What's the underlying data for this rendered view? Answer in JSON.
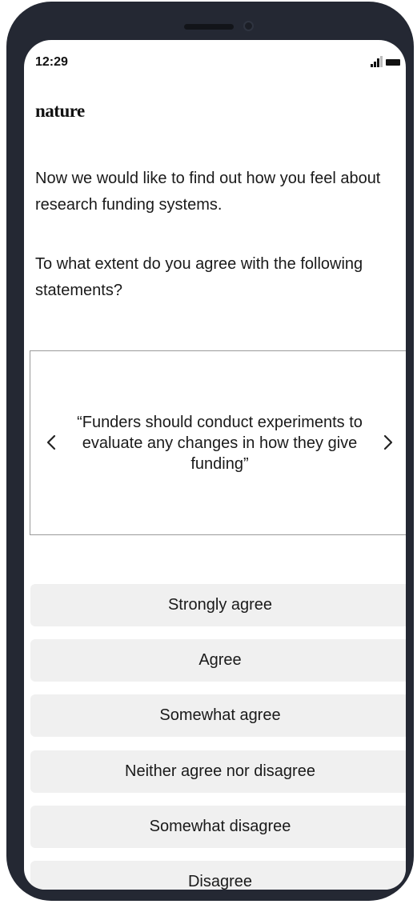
{
  "status_bar": {
    "time": "12:29",
    "signal_icon": "cellular-signal-icon",
    "battery_icon": "battery-icon"
  },
  "header": {
    "logo": "nature"
  },
  "survey": {
    "intro": "Now we would like to find out how you feel about research funding systems.",
    "question": "To what extent do you agree with the following statements?",
    "statement": "“Funders should conduct experiments to evaluate any changes in how they give funding”",
    "prev_icon": "chevron-left-icon",
    "next_icon": "chevron-right-icon",
    "options": [
      "Strongly agree",
      "Agree",
      "Somewhat agree",
      "Neither agree nor disagree",
      "Somewhat disagree",
      "Disagree"
    ]
  },
  "colors": {
    "device_frame": "#242833",
    "option_background": "#f0f0f0",
    "text": "#1a1a1a"
  }
}
